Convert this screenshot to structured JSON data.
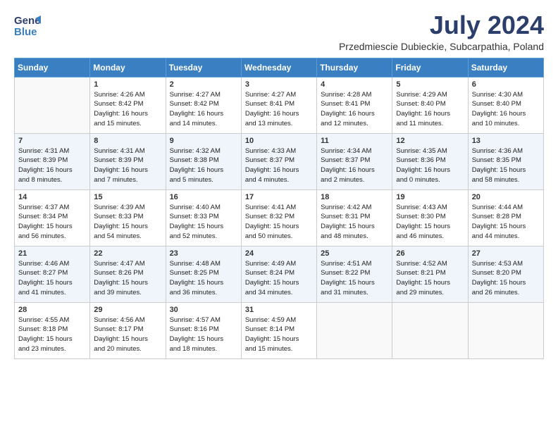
{
  "header": {
    "logo_general": "General",
    "logo_blue": "Blue",
    "month_title": "July 2024",
    "subtitle": "Przedmiescie Dubieckie, Subcarpathia, Poland"
  },
  "weekdays": [
    "Sunday",
    "Monday",
    "Tuesday",
    "Wednesday",
    "Thursday",
    "Friday",
    "Saturday"
  ],
  "weeks": [
    [
      {
        "day": "",
        "info": ""
      },
      {
        "day": "1",
        "info": "Sunrise: 4:26 AM\nSunset: 8:42 PM\nDaylight: 16 hours\nand 15 minutes."
      },
      {
        "day": "2",
        "info": "Sunrise: 4:27 AM\nSunset: 8:42 PM\nDaylight: 16 hours\nand 14 minutes."
      },
      {
        "day": "3",
        "info": "Sunrise: 4:27 AM\nSunset: 8:41 PM\nDaylight: 16 hours\nand 13 minutes."
      },
      {
        "day": "4",
        "info": "Sunrise: 4:28 AM\nSunset: 8:41 PM\nDaylight: 16 hours\nand 12 minutes."
      },
      {
        "day": "5",
        "info": "Sunrise: 4:29 AM\nSunset: 8:40 PM\nDaylight: 16 hours\nand 11 minutes."
      },
      {
        "day": "6",
        "info": "Sunrise: 4:30 AM\nSunset: 8:40 PM\nDaylight: 16 hours\nand 10 minutes."
      }
    ],
    [
      {
        "day": "7",
        "info": "Sunrise: 4:31 AM\nSunset: 8:39 PM\nDaylight: 16 hours\nand 8 minutes."
      },
      {
        "day": "8",
        "info": "Sunrise: 4:31 AM\nSunset: 8:39 PM\nDaylight: 16 hours\nand 7 minutes."
      },
      {
        "day": "9",
        "info": "Sunrise: 4:32 AM\nSunset: 8:38 PM\nDaylight: 16 hours\nand 5 minutes."
      },
      {
        "day": "10",
        "info": "Sunrise: 4:33 AM\nSunset: 8:37 PM\nDaylight: 16 hours\nand 4 minutes."
      },
      {
        "day": "11",
        "info": "Sunrise: 4:34 AM\nSunset: 8:37 PM\nDaylight: 16 hours\nand 2 minutes."
      },
      {
        "day": "12",
        "info": "Sunrise: 4:35 AM\nSunset: 8:36 PM\nDaylight: 16 hours\nand 0 minutes."
      },
      {
        "day": "13",
        "info": "Sunrise: 4:36 AM\nSunset: 8:35 PM\nDaylight: 15 hours\nand 58 minutes."
      }
    ],
    [
      {
        "day": "14",
        "info": "Sunrise: 4:37 AM\nSunset: 8:34 PM\nDaylight: 15 hours\nand 56 minutes."
      },
      {
        "day": "15",
        "info": "Sunrise: 4:39 AM\nSunset: 8:33 PM\nDaylight: 15 hours\nand 54 minutes."
      },
      {
        "day": "16",
        "info": "Sunrise: 4:40 AM\nSunset: 8:33 PM\nDaylight: 15 hours\nand 52 minutes."
      },
      {
        "day": "17",
        "info": "Sunrise: 4:41 AM\nSunset: 8:32 PM\nDaylight: 15 hours\nand 50 minutes."
      },
      {
        "day": "18",
        "info": "Sunrise: 4:42 AM\nSunset: 8:31 PM\nDaylight: 15 hours\nand 48 minutes."
      },
      {
        "day": "19",
        "info": "Sunrise: 4:43 AM\nSunset: 8:30 PM\nDaylight: 15 hours\nand 46 minutes."
      },
      {
        "day": "20",
        "info": "Sunrise: 4:44 AM\nSunset: 8:28 PM\nDaylight: 15 hours\nand 44 minutes."
      }
    ],
    [
      {
        "day": "21",
        "info": "Sunrise: 4:46 AM\nSunset: 8:27 PM\nDaylight: 15 hours\nand 41 minutes."
      },
      {
        "day": "22",
        "info": "Sunrise: 4:47 AM\nSunset: 8:26 PM\nDaylight: 15 hours\nand 39 minutes."
      },
      {
        "day": "23",
        "info": "Sunrise: 4:48 AM\nSunset: 8:25 PM\nDaylight: 15 hours\nand 36 minutes."
      },
      {
        "day": "24",
        "info": "Sunrise: 4:49 AM\nSunset: 8:24 PM\nDaylight: 15 hours\nand 34 minutes."
      },
      {
        "day": "25",
        "info": "Sunrise: 4:51 AM\nSunset: 8:22 PM\nDaylight: 15 hours\nand 31 minutes."
      },
      {
        "day": "26",
        "info": "Sunrise: 4:52 AM\nSunset: 8:21 PM\nDaylight: 15 hours\nand 29 minutes."
      },
      {
        "day": "27",
        "info": "Sunrise: 4:53 AM\nSunset: 8:20 PM\nDaylight: 15 hours\nand 26 minutes."
      }
    ],
    [
      {
        "day": "28",
        "info": "Sunrise: 4:55 AM\nSunset: 8:18 PM\nDaylight: 15 hours\nand 23 minutes."
      },
      {
        "day": "29",
        "info": "Sunrise: 4:56 AM\nSunset: 8:17 PM\nDaylight: 15 hours\nand 20 minutes."
      },
      {
        "day": "30",
        "info": "Sunrise: 4:57 AM\nSunset: 8:16 PM\nDaylight: 15 hours\nand 18 minutes."
      },
      {
        "day": "31",
        "info": "Sunrise: 4:59 AM\nSunset: 8:14 PM\nDaylight: 15 hours\nand 15 minutes."
      },
      {
        "day": "",
        "info": ""
      },
      {
        "day": "",
        "info": ""
      },
      {
        "day": "",
        "info": ""
      }
    ]
  ]
}
